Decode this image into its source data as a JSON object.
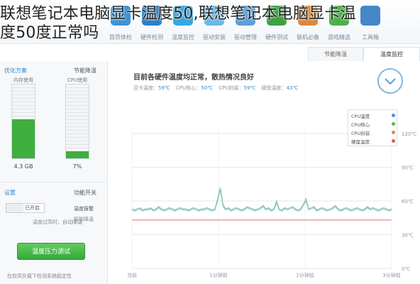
{
  "overlay": {
    "line1": "联想笔记本电脑显卡温度50,联想笔记本电脑显卡温",
    "line2": "度50度正常吗"
  },
  "toolbar": {
    "items": [
      {
        "label": "首页体检",
        "icon": "home-icon",
        "color": "#3b95d8"
      },
      {
        "label": "硬件检测",
        "icon": "computer-icon",
        "color": "#2f7fc1"
      },
      {
        "label": "温度监控",
        "icon": "thermometer-icon",
        "color": "#38a7e0"
      },
      {
        "label": "驱动安装",
        "icon": "cube-icon",
        "color": "#6bb7e8"
      },
      {
        "label": "驱动管理",
        "icon": "gear-icon",
        "color": "#5f9fd6"
      },
      {
        "label": "硬件测试",
        "icon": "checklist-icon",
        "color": "#40a040"
      },
      {
        "label": "装机必备",
        "icon": "box-icon",
        "color": "#d9893f"
      },
      {
        "label": "游戏精选",
        "icon": "game-icon",
        "color": "#4ab04a"
      },
      {
        "label": "工具箱",
        "icon": "toolbox-icon",
        "color": "#4687c8"
      }
    ]
  },
  "tabs": [
    "节能降温",
    "温度监控"
  ],
  "left": {
    "section1": "节能降温",
    "section1_link": "优化方案",
    "meter1_caption": "内存使用",
    "meter2_caption": "CPU使用",
    "meter1_value": "4.3 GB",
    "meter2_value": "7%",
    "switch_title": "功能开关",
    "switch_link": "设置",
    "toggle_label": "已开启",
    "switch_note": "温度报警",
    "switch_note2": "智能降温",
    "overheat_note": "温度过高时，自动降温",
    "button_label": "温度压力测试",
    "footer_note": "在较高负载下检测系统稳定性"
  },
  "status": {
    "title": "目前各硬件温度均正常，散热情况良好",
    "items": [
      {
        "label": "显卡温度：",
        "value": "59℃"
      },
      {
        "label": "CPU核心：",
        "value": "50℃"
      },
      {
        "label": "CPU封装：",
        "value": "59℃"
      },
      {
        "label": "硬盘温度：",
        "value": "43℃"
      }
    ]
  },
  "legend": [
    {
      "label": "CPU温度",
      "color": "#3b95d8"
    },
    {
      "label": "CPU核心",
      "color": "#5ab55a"
    },
    {
      "label": "CPU封装",
      "color": "#d98c4a"
    },
    {
      "label": "硬盘温度",
      "color": "#e05858"
    }
  ],
  "chart_data": {
    "type": "line",
    "ytick_labels": [
      "120℃",
      "90℃",
      "60℃",
      "30℃",
      "0℃"
    ],
    "yticks": [
      120,
      90,
      60,
      30,
      0
    ],
    "ylim": [
      0,
      125
    ],
    "xtick_labels": [
      "当前",
      "1分钟前",
      "2分钟前",
      "3分钟前"
    ],
    "grid": true,
    "series": [
      {
        "name": "CPU温度",
        "color": "#8bbde0",
        "values": [
          52,
          51,
          52,
          53,
          51,
          52,
          52,
          53,
          51,
          52,
          54,
          52,
          51,
          52,
          53,
          52,
          51,
          52,
          53,
          52,
          52,
          51,
          52,
          53,
          52,
          51,
          52,
          52,
          53,
          52,
          51,
          52,
          60,
          70,
          55,
          52,
          53,
          51,
          52,
          53,
          52,
          51,
          52,
          54,
          53,
          52,
          51,
          52,
          53,
          55,
          52,
          53,
          51,
          52,
          58,
          52,
          51,
          53,
          52,
          53,
          54,
          52,
          51,
          52,
          56,
          60,
          52,
          53,
          54,
          51,
          52,
          53,
          52,
          51,
          52,
          53,
          55,
          52,
          51,
          52,
          53,
          52,
          51,
          52,
          53,
          52,
          51,
          52,
          54,
          52,
          53,
          52,
          51,
          52,
          53,
          52,
          51,
          52
        ]
      },
      {
        "name": "CPU核心",
        "color": "#8fcf8f",
        "values": [
          53,
          52,
          53,
          54,
          52,
          53,
          53,
          54,
          52,
          53,
          55,
          53,
          52,
          53,
          54,
          53,
          52,
          53,
          54,
          53,
          53,
          52,
          53,
          54,
          53,
          52,
          53,
          53,
          54,
          53,
          52,
          53,
          62,
          72,
          57,
          53,
          54,
          52,
          53,
          54,
          53,
          52,
          53,
          55,
          54,
          53,
          52,
          53,
          54,
          56,
          53,
          54,
          52,
          53,
          60,
          53,
          52,
          54,
          53,
          54,
          55,
          53,
          52,
          53,
          57,
          62,
          53,
          54,
          55,
          52,
          53,
          54,
          53,
          52,
          53,
          54,
          56,
          53,
          52,
          53,
          54,
          53,
          52,
          53,
          54,
          53,
          52,
          53,
          55,
          53,
          54,
          53,
          52,
          53,
          54,
          53,
          52,
          53
        ]
      },
      {
        "name": "硬盘温度",
        "color": "#e58a8a",
        "values": [
          43,
          43,
          43,
          43,
          43,
          43,
          43,
          43,
          43,
          43,
          43,
          43,
          43,
          43,
          43,
          43,
          43,
          43,
          43,
          43,
          43,
          43,
          43,
          43,
          43,
          43,
          43,
          43,
          43,
          43,
          43,
          43,
          43,
          43,
          43,
          43,
          43,
          43,
          43,
          43,
          43,
          43,
          43,
          43,
          43,
          43,
          43,
          43,
          43,
          43,
          43,
          43,
          43,
          43,
          43,
          43,
          43,
          43,
          43,
          43,
          43,
          43,
          43,
          43,
          43,
          43,
          43,
          43,
          43,
          43,
          43,
          43,
          43,
          43,
          43,
          43,
          43,
          43,
          43,
          43,
          43,
          43,
          43,
          43,
          43,
          43,
          43,
          43,
          43,
          43,
          43,
          43,
          43,
          43,
          43,
          43,
          43,
          43
        ]
      }
    ]
  }
}
